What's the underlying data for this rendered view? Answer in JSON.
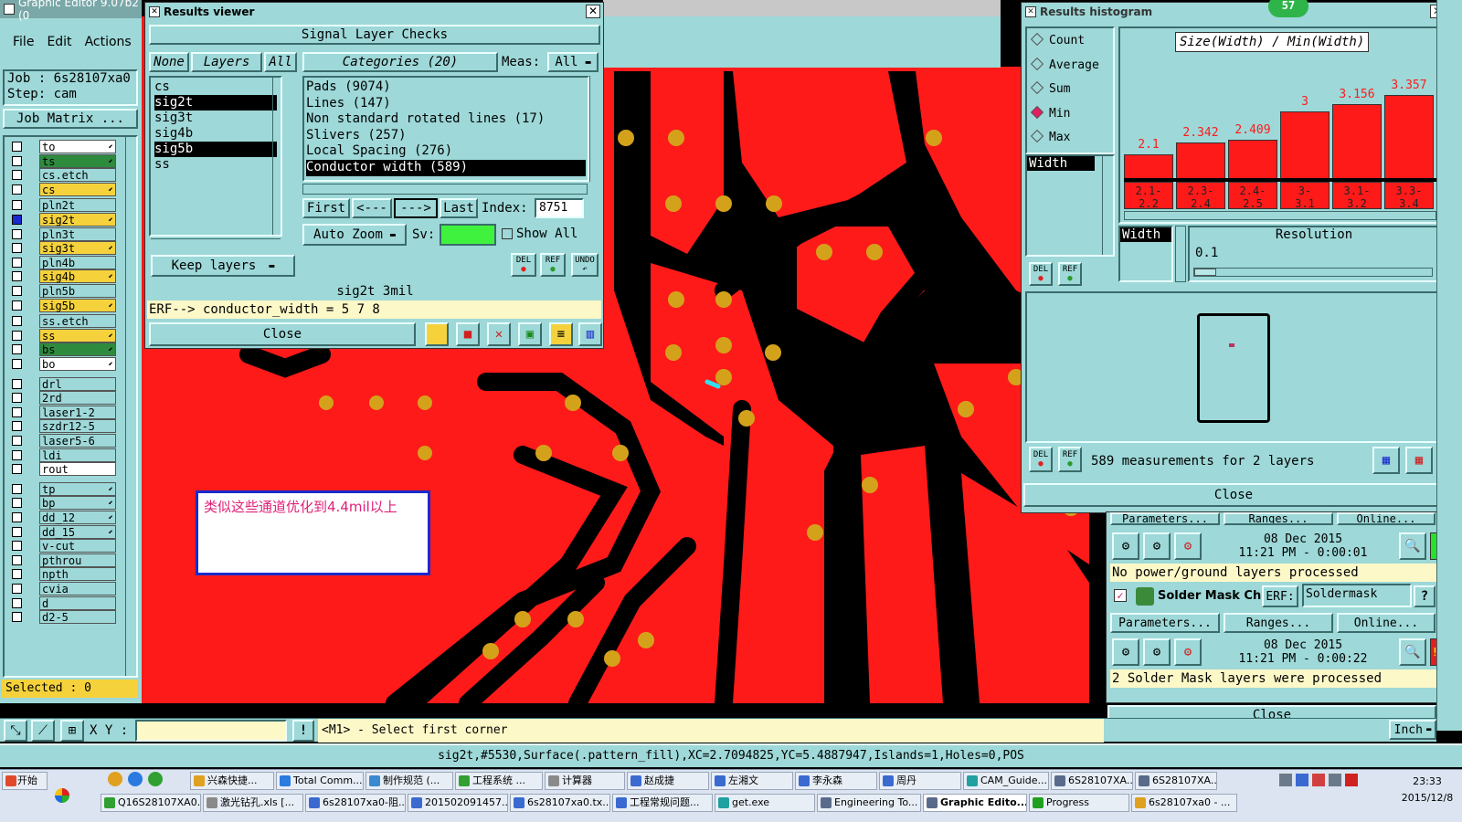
{
  "app": {
    "title": "Graphic Editor 9.07b2 (0"
  },
  "menu": {
    "file": "File",
    "edit": "Edit",
    "actions": "Actions"
  },
  "job": {
    "job_label": "Job : 6s28107xa0",
    "step_label": "Step: cam",
    "matrix_button": "Job Matrix ..."
  },
  "layers": [
    {
      "name": "to",
      "style": "wh",
      "arrow": true
    },
    {
      "name": "ts",
      "style": "gr",
      "arrow": true
    },
    {
      "name": "cs.etch",
      "style": "",
      "arrow": false
    },
    {
      "name": "cs",
      "style": "hl",
      "arrow": true
    },
    {
      "name": "pln2t",
      "style": "",
      "arrow": false
    },
    {
      "name": "sig2t",
      "style": "hl",
      "arrow": true,
      "checked": true
    },
    {
      "name": "pln3t",
      "style": "",
      "arrow": false
    },
    {
      "name": "sig3t",
      "style": "hl",
      "arrow": true
    },
    {
      "name": "pln4b",
      "style": "",
      "arrow": false
    },
    {
      "name": "sig4b",
      "style": "hl",
      "arrow": true
    },
    {
      "name": "pln5b",
      "style": "",
      "arrow": false
    },
    {
      "name": "sig5b",
      "style": "hl",
      "arrow": true
    },
    {
      "name": "ss.etch",
      "style": "",
      "arrow": false
    },
    {
      "name": "ss",
      "style": "hl",
      "arrow": true
    },
    {
      "name": "bs",
      "style": "gr",
      "arrow": true
    },
    {
      "name": "bo",
      "style": "wh",
      "arrow": true
    },
    {
      "name": "drl",
      "style": "",
      "arrow": false
    },
    {
      "name": "2rd",
      "style": "",
      "arrow": false
    },
    {
      "name": "laser1-2",
      "style": "",
      "arrow": false
    },
    {
      "name": "szdr12-5",
      "style": "",
      "arrow": false
    },
    {
      "name": "laser5-6",
      "style": "",
      "arrow": false
    },
    {
      "name": "ldi",
      "style": "",
      "arrow": false
    },
    {
      "name": "rout",
      "style": "wh",
      "arrow": false
    },
    {
      "name": "tp",
      "style": "",
      "arrow": true
    },
    {
      "name": "bp",
      "style": "",
      "arrow": true
    },
    {
      "name": "dd_12",
      "style": "",
      "arrow": true
    },
    {
      "name": "dd_15",
      "style": "",
      "arrow": true
    },
    {
      "name": "v-cut",
      "style": "",
      "arrow": false
    },
    {
      "name": "pthrou",
      "style": "",
      "arrow": false
    },
    {
      "name": "npth",
      "style": "",
      "arrow": false
    },
    {
      "name": "cvia",
      "style": "",
      "arrow": false
    },
    {
      "name": "d",
      "style": "",
      "arrow": false
    },
    {
      "name": "d2-5",
      "style": "",
      "arrow": false
    }
  ],
  "selected_label": "Selected : 0",
  "results_viewer": {
    "title": "Results viewer",
    "header": "Signal Layer Checks",
    "tab_none": "None",
    "tab_layers": "Layers",
    "tab_all": "All",
    "categories_label": "Categories (20)",
    "meas_label": "Meas:",
    "meas_value": "All",
    "layer_list": [
      "cs",
      "sig2t",
      "sig3t",
      "sig4b",
      "sig5b",
      "ss"
    ],
    "categories": [
      "Pads (9074)",
      "Lines (147)",
      "Non standard rotated lines (17)",
      "Slivers (257)",
      "Local Spacing (276)",
      "Conductor width (589)"
    ],
    "first": "First",
    "prev": "<---",
    "next": "--->",
    "last": "Last",
    "index_label": "Index:",
    "index_value": "8751",
    "auto_zoom": "Auto Zoom",
    "sv_label": "Sv:",
    "show_all": "Show All",
    "keep_layers": "Keep layers",
    "del": "DEL",
    "ref": "REF",
    "undo": "UNDO",
    "status": "sig2t 3mil",
    "erf": "ERF--> conductor_width = 5 7 8",
    "close": "Close"
  },
  "annotation": {
    "text": "类似这些通道优化到4.4mil以上"
  },
  "histogram": {
    "title": "Results histogram",
    "badge": "57",
    "options": [
      "Count",
      "Average",
      "Sum",
      "Min",
      "Max"
    ],
    "selected_option": "Min",
    "chart_title": "Size(Width) / Min(Width)",
    "field_list": [
      "Width"
    ],
    "values": [
      "2.1",
      "2.342",
      "2.409",
      "3",
      "3.156",
      "3.357"
    ],
    "bins": [
      "2.1-\n2.2",
      "2.3-\n2.4",
      "2.4-\n2.5",
      "3-\n3.1",
      "3.1-\n3.2",
      "3.3-\n3.4"
    ],
    "resolution_label": "Resolution",
    "resolution_field": "Width",
    "resolution_value": "0.1",
    "summary": "589 measurements for 2 layers",
    "close": "Close"
  },
  "chart_data": {
    "type": "bar",
    "title": "Size(Width) / Min(Width)",
    "categories": [
      "2.1-2.2",
      "2.3-2.4",
      "2.4-2.5",
      "3-3.1",
      "3.1-3.2",
      "3.3-3.4"
    ],
    "values": [
      2.1,
      2.342,
      2.409,
      3,
      3.156,
      3.357
    ]
  },
  "checklist": {
    "params": "Parameters...",
    "ranges": "Ranges...",
    "online": "Online...",
    "row1_date": "08 Dec 2015",
    "row1_time": "11:21 PM - 0:00:01",
    "row1_msg": "No power/ground layers processed",
    "solder_label": "Solder Mask Ch",
    "erf_label": "ERF:",
    "erf_value": "Soldermask",
    "row2_date": "08 Dec 2015",
    "row2_time": "11:21 PM - 0:00:22",
    "row2_msg": "2 Solder Mask layers were processed",
    "close": "Close",
    "units": "Inch"
  },
  "bottom": {
    "xy_label": "X Y :",
    "prompt": "<M1> - Select first corner",
    "status_line": "sig2t,#5530,Surface(.pattern_fill),XC=2.7094825,YC=5.4887947,Islands=1,Holes=0,POS"
  },
  "taskbar": {
    "start": "开始",
    "row1": [
      "兴森快捷...",
      "Total Comm...",
      "制作规范 (...",
      "工程系统 ...",
      "计算器",
      "赵成捷",
      "左湘文",
      "李永森",
      "周丹",
      "CAM_Guide...",
      "6S28107XA...",
      "6S28107XA..."
    ],
    "row2": [
      "Q16S28107XA0...",
      "激光钻孔.xls [...",
      "6s28107xa0-阻...",
      "201502091457...",
      "6s28107xa0.tx...",
      "工程常规问题...",
      "get.exe",
      "Engineering To...",
      "Graphic Edito...",
      "Progress",
      "6s28107xa0 - ..."
    ],
    "clock_time": "23:33",
    "clock_date": "2015/12/8"
  }
}
